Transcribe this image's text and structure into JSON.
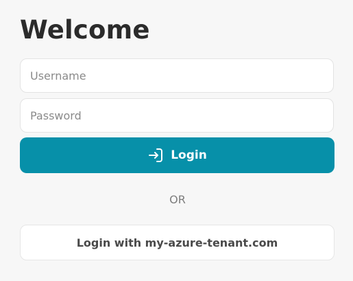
{
  "heading": "Welcome",
  "username": {
    "placeholder": "Username",
    "value": ""
  },
  "password": {
    "placeholder": "Password",
    "value": ""
  },
  "login_button": {
    "label": "Login",
    "icon": "login-icon"
  },
  "divider_text": "OR",
  "alt_login_button": {
    "label": "Login with my-azure-tenant.com"
  },
  "colors": {
    "background": "#f7f7f7",
    "primary": "#0790a9",
    "heading": "#2b2b2b",
    "muted": "#7d7d7d"
  }
}
